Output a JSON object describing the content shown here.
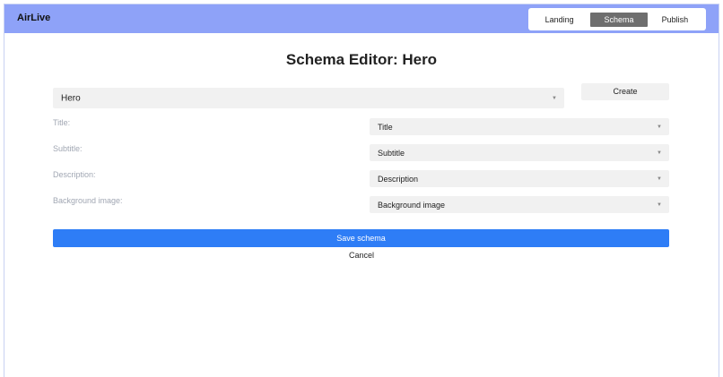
{
  "header": {
    "brand": "AirLive",
    "nav": [
      {
        "label": "Landing",
        "active": false
      },
      {
        "label": "Schema",
        "active": true
      },
      {
        "label": "Publish",
        "active": false
      }
    ]
  },
  "main": {
    "title": "Schema Editor: Hero",
    "schema_select": {
      "value": "Hero"
    },
    "create_label": "Create",
    "fields": [
      {
        "label": "Title:",
        "value": "Title"
      },
      {
        "label": "Subtitle:",
        "value": "Subtitle"
      },
      {
        "label": "Description:",
        "value": "Description"
      },
      {
        "label": "Background image:",
        "value": "Background image"
      }
    ],
    "save_label": "Save schema",
    "cancel_label": "Cancel"
  },
  "colors": {
    "header_bg": "#8ea2f8",
    "primary": "#2e7df6",
    "active_tab": "#6e6e6e",
    "label_muted": "#a1a7b3"
  },
  "icons": {
    "caret": "caret-down-icon"
  }
}
